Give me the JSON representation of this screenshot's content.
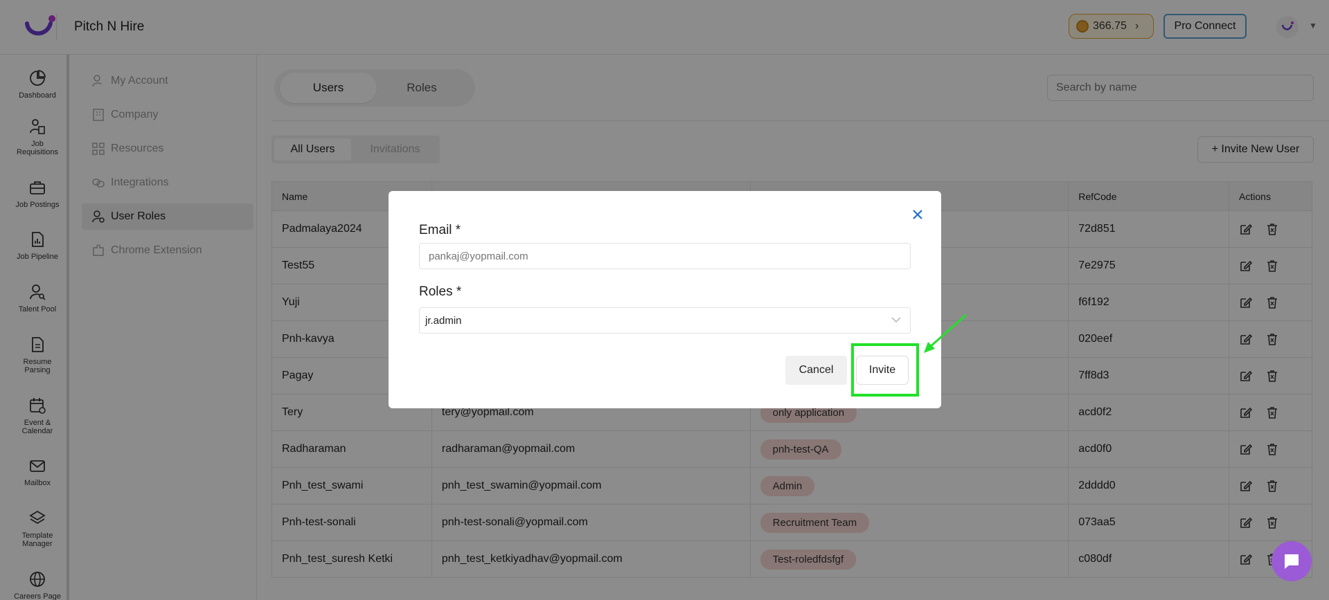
{
  "app": {
    "brand": "Pitch N Hire",
    "accent": "#22e02a"
  },
  "header": {
    "coins": "366.75",
    "pro_connect": "Pro Connect"
  },
  "rail": [
    {
      "label": "Dashboard",
      "icon": "pie-chart-icon"
    },
    {
      "label": "Job Requisitions",
      "icon": "user-document-icon"
    },
    {
      "label": "Job Postings",
      "icon": "briefcase-icon"
    },
    {
      "label": "Job Pipeline",
      "icon": "report-icon"
    },
    {
      "label": "Talent Pool",
      "icon": "user-search-icon"
    },
    {
      "label": "Resume Parsing",
      "icon": "document-icon"
    },
    {
      "label": "Event & Calendar",
      "icon": "calendar-icon"
    },
    {
      "label": "Mailbox",
      "icon": "mail-icon"
    },
    {
      "label": "Template Manager",
      "icon": "layers-icon"
    },
    {
      "label": "Careers Page",
      "icon": "globe-icon"
    }
  ],
  "menu": [
    {
      "label": "My Account"
    },
    {
      "label": "Company"
    },
    {
      "label": "Resources"
    },
    {
      "label": "Integrations"
    },
    {
      "label": "User Roles"
    },
    {
      "label": "Chrome Extension"
    }
  ],
  "tabs": {
    "users": "Users",
    "roles": "Roles"
  },
  "search": {
    "placeholder": "Search by name"
  },
  "subtabs": {
    "all_users": "All Users",
    "invitations": "Invitations"
  },
  "invite_new": "+ Invite New User",
  "table": {
    "headers": {
      "name": "Name",
      "email": "",
      "role": "",
      "refcode": "RefCode",
      "actions": "Actions"
    },
    "rows": [
      {
        "name": "Padmalaya2024",
        "email": "",
        "role": "",
        "refcode": "72d851"
      },
      {
        "name": "Test55",
        "email": "",
        "role": "",
        "refcode": "7e2975"
      },
      {
        "name": "Yuji",
        "email": "",
        "role": "",
        "refcode": "f6f192"
      },
      {
        "name": "Pnh-kavya",
        "email": "",
        "role": "",
        "refcode": "020eef"
      },
      {
        "name": "Pagay",
        "email": "",
        "role": "",
        "refcode": "7ff8d3"
      },
      {
        "name": "Tery",
        "email": "tery@yopmail.com",
        "role": "only application",
        "refcode": "acd0f2"
      },
      {
        "name": "Radharaman",
        "email": "radharaman@yopmail.com",
        "role": "pnh-test-QA",
        "refcode": "acd0f0"
      },
      {
        "name": "Pnh_test_swami",
        "email": "pnh_test_swamin@yopmail.com",
        "role": "Admin",
        "refcode": "2dddd0"
      },
      {
        "name": "Pnh-test-sonali",
        "email": "pnh-test-sonali@yopmail.com",
        "role": "Recruitment Team",
        "refcode": "073aa5"
      },
      {
        "name": "Pnh_test_suresh Ketki",
        "email": "pnh_test_ketkiyadhav@yopmail.com",
        "role": "Test-roledfdsfgf",
        "refcode": "c080df"
      }
    ]
  },
  "modal": {
    "email_label": "Email *",
    "email_placeholder": "pankaj@yopmail.com",
    "roles_label": "Roles *",
    "roles_value": "jr.admin",
    "cancel": "Cancel",
    "invite": "Invite"
  }
}
